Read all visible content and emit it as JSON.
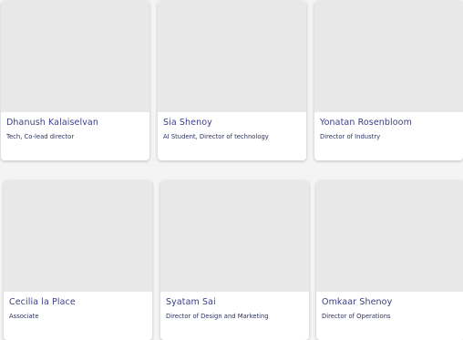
{
  "members": [
    {
      "name": "Dhanush Kalaiselvan",
      "role": "Tech, Co-lead director"
    },
    {
      "name": "Sia Shenoy",
      "role": "AI Student, Director of technology"
    },
    {
      "name": "Yonatan Rosenbloom",
      "role": "Director of Industry"
    },
    {
      "name": "Cecilia la Place",
      "role": "Associate"
    },
    {
      "name": "Syatam Sai",
      "role": "Director of  Design and Marketing"
    },
    {
      "name": "Omkaar Shenoy",
      "role": "Director of  Operations"
    }
  ],
  "colors": {
    "page_background": "#f4f4f4",
    "card_background": "#ffffff",
    "photo_placeholder": "#e8e8e8",
    "name_text": "#3b3f86",
    "role_text": "#2d3163"
  }
}
